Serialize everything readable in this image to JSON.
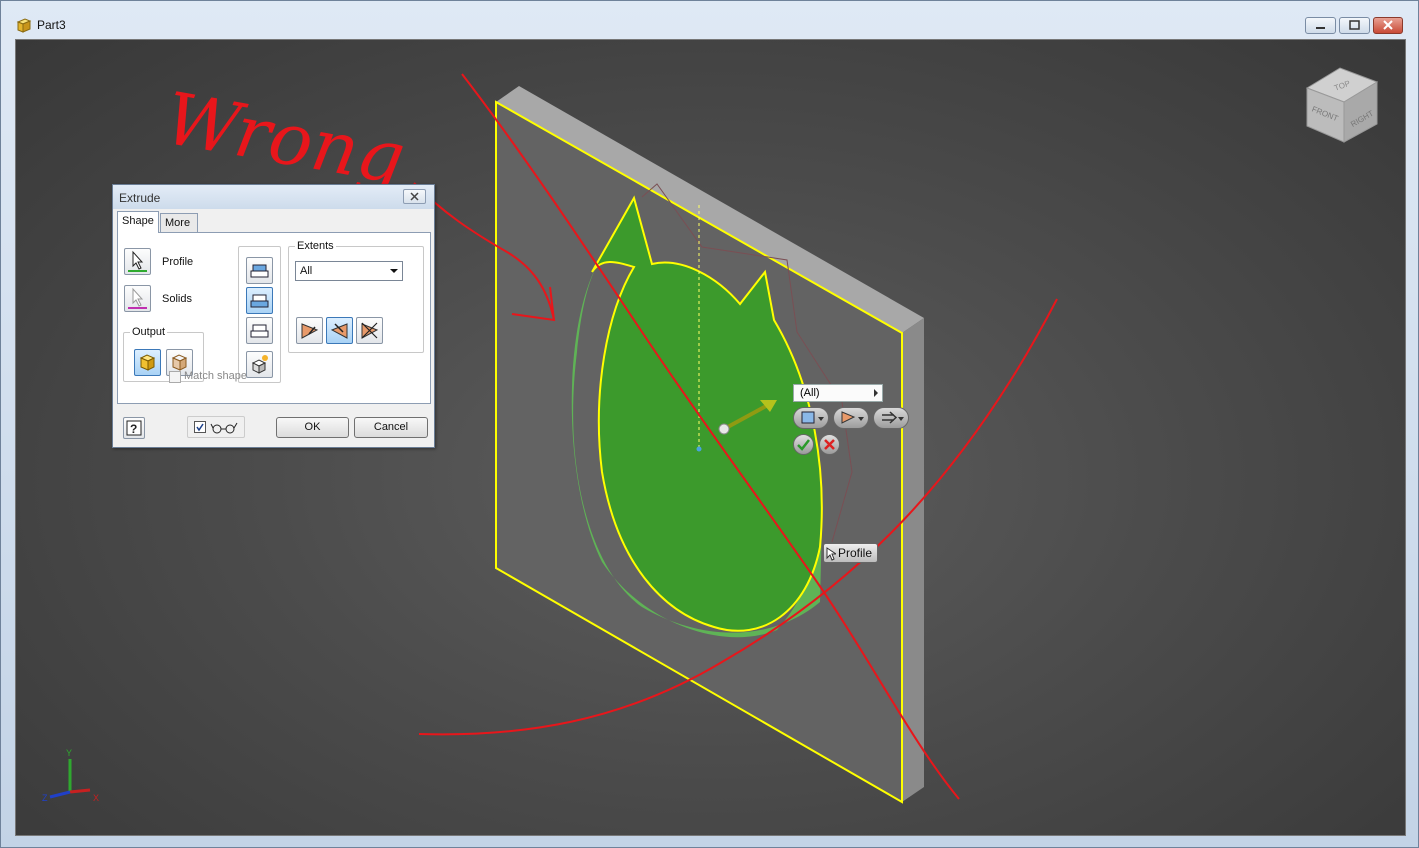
{
  "window": {
    "title": "Part3"
  },
  "annotation": {
    "text": "Wrong",
    "color": "#e8161b"
  },
  "dialog": {
    "title": "Extrude",
    "tabs": [
      "Shape",
      "More"
    ],
    "profile_label": "Profile",
    "solids_label": "Solids",
    "output_label": "Output",
    "extents_label": "Extents",
    "extents_value": "All",
    "match_shape_label": "Match shape",
    "ok_label": "OK",
    "cancel_label": "Cancel"
  },
  "mini_toolbar": {
    "extents_value": "(All)"
  },
  "tooltip": {
    "label": "Profile"
  },
  "viewcube": {
    "top": "TOP",
    "front": "FRONT",
    "right": "RIGHT"
  },
  "triad": {
    "x": "X",
    "y": "Y",
    "z": "Z"
  },
  "colors": {
    "highlight": "#ffff00",
    "extrusion": "#3c9a2c",
    "background": "#4a4a4a"
  }
}
